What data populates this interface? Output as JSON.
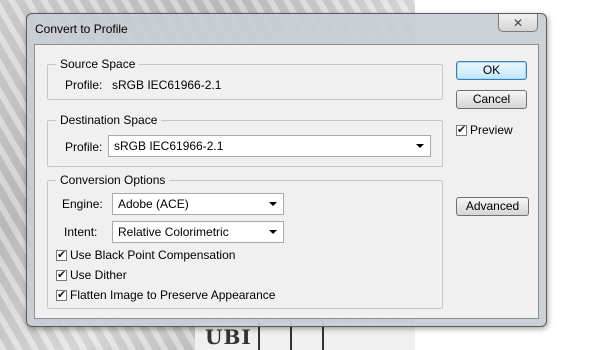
{
  "dialog": {
    "title": "Convert to Profile",
    "close_symbol": "✕"
  },
  "source": {
    "legend": "Source Space",
    "profile_label": "Profile:",
    "profile_value": "sRGB IEC61966-2.1"
  },
  "destination": {
    "legend": "Destination Space",
    "profile_label": "Profile:",
    "profile_value": "sRGB IEC61966-2.1"
  },
  "conversion": {
    "legend": "Conversion Options",
    "engine_label": "Engine:",
    "engine_value": "Adobe (ACE)",
    "intent_label": "Intent:",
    "intent_value": "Relative Colorimetric",
    "options": [
      {
        "label": "Use Black Point Compensation",
        "checked": true
      },
      {
        "label": "Use Dither",
        "checked": true
      },
      {
        "label": "Flatten Image to Preserve Appearance",
        "checked": true
      }
    ]
  },
  "buttons": {
    "ok": "OK",
    "cancel": "Cancel",
    "advanced": "Advanced"
  },
  "preview": {
    "label": "Preview",
    "checked": true
  },
  "check_glyph": "✔",
  "background": {
    "logo_text": "UBI"
  },
  "colors": {
    "default_button_border": "#3c7fb1",
    "dialog_frame": "#c8cdd4"
  }
}
